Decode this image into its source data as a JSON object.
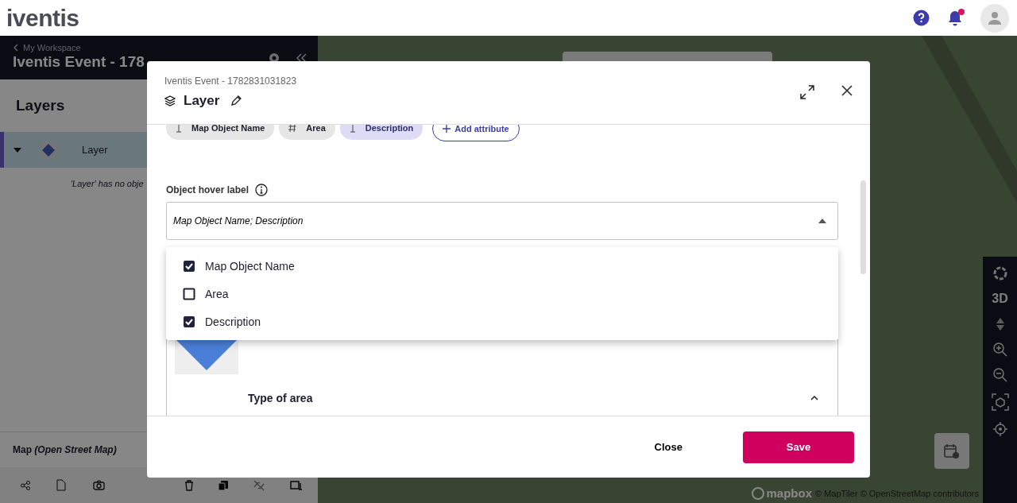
{
  "header": {
    "logo": "iventis",
    "notifications_unread": true
  },
  "sidebar": {
    "back_link": "My Workspace",
    "title": "Iventis Event - 178",
    "section_title": "Layers",
    "layers": [
      {
        "name": "Layer",
        "selected": true,
        "expanded": true,
        "empty_message": "'Layer' has no obje"
      }
    ],
    "basemap": "Map *(Open Street Map)*"
  },
  "map": {
    "toggle_3d": "3D",
    "attribution": "© MapTiler © OpenStreetMap contributors",
    "logo": "mapbox"
  },
  "modal": {
    "subtitle": "Iventis Event - 1782831031823",
    "title": "Layer",
    "attributes": [
      {
        "label": "Map Object Name",
        "kind": "text",
        "selected": false
      },
      {
        "label": "Area",
        "kind": "number",
        "selected": false
      },
      {
        "label": "Description",
        "kind": "text",
        "selected": true
      }
    ],
    "add_attribute": "Add attribute",
    "hover_label": {
      "label": "Object hover label",
      "value": "Map Object Name; Description",
      "expanded": true,
      "options": [
        {
          "label": "Map Object Name",
          "checked": true
        },
        {
          "label": "Area",
          "checked": false
        },
        {
          "label": "Description",
          "checked": true
        }
      ]
    },
    "style_section": {
      "title": "Type of area",
      "expanded": true
    },
    "buttons": {
      "close": "Close",
      "save": "Save"
    }
  }
}
